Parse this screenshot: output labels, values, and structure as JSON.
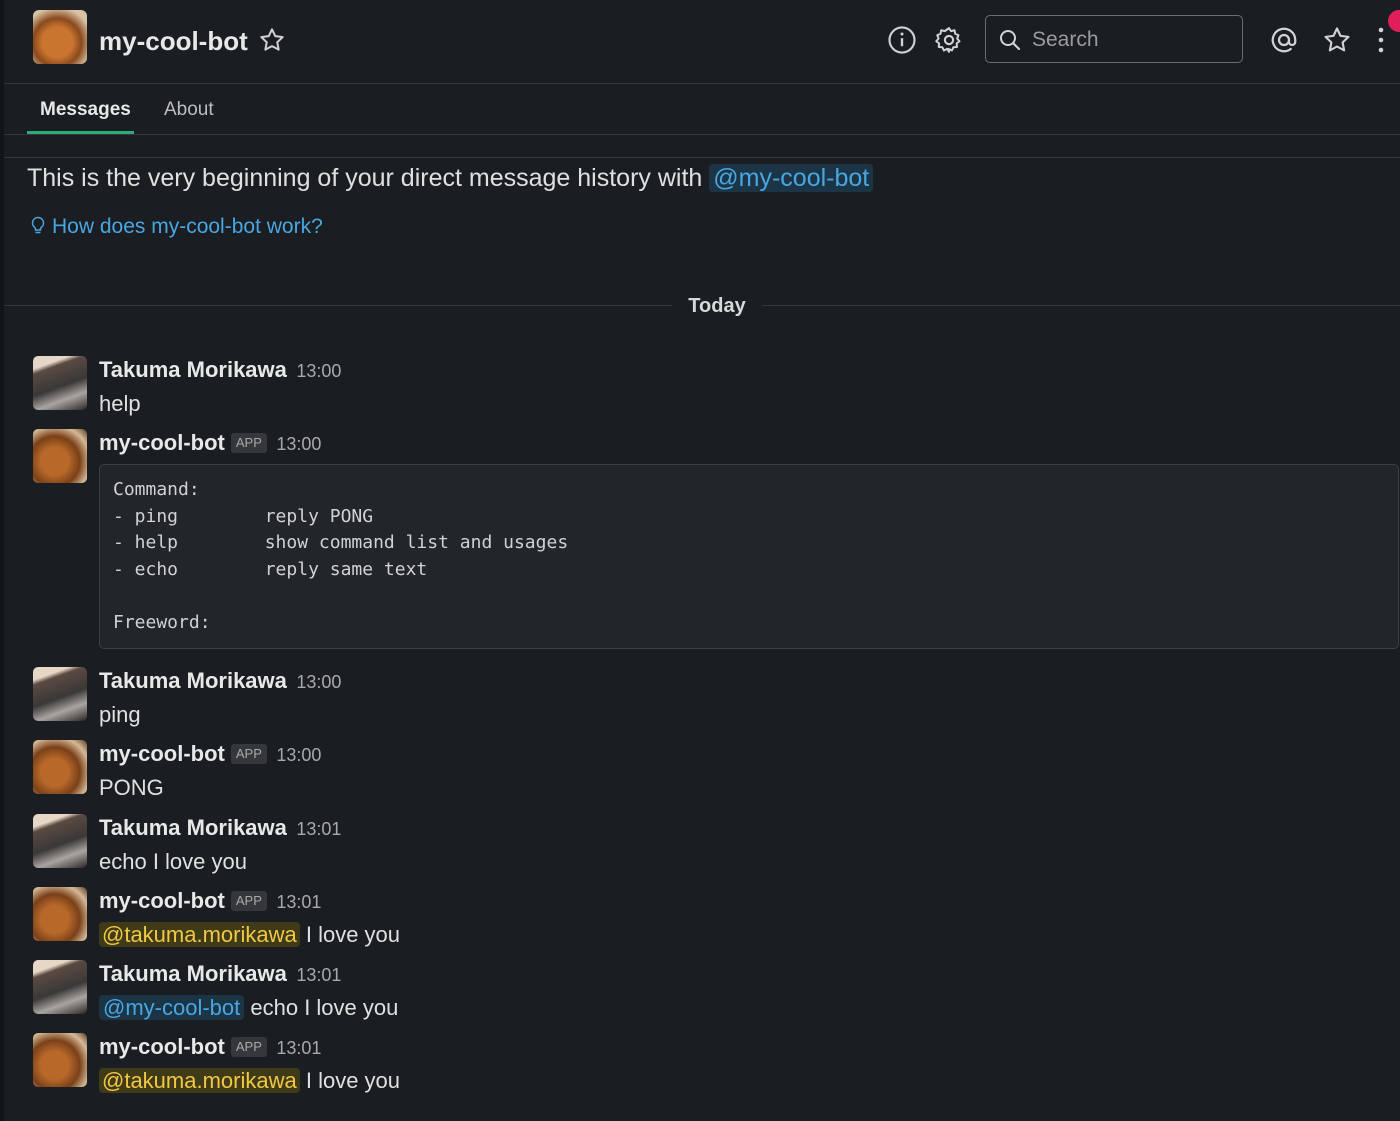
{
  "header": {
    "title": "my-cool-bot",
    "search_placeholder": "Search",
    "icons": [
      "info-icon",
      "gear-icon",
      "search-icon",
      "mention-icon",
      "star-icon",
      "more-icon"
    ]
  },
  "tabs": {
    "messages": "Messages",
    "about": "About"
  },
  "intro": {
    "text": "This is the very beginning of your direct message history with",
    "mention": "@my-cool-bot",
    "howto": "How does my-cool-bot work?"
  },
  "divider": "Today",
  "app_badge": "APP",
  "messages": [
    {
      "author": "Takuma Morikawa",
      "time": "13:00",
      "text": "help"
    },
    {
      "author": "my-cool-bot",
      "time": "13:00",
      "code": [
        "Command:",
        "- ping        reply PONG",
        "- help        show command list and usages",
        "- echo        reply same text",
        "",
        "Freeword:"
      ]
    },
    {
      "author": "Takuma Morikawa",
      "time": "13:00",
      "text": "ping"
    },
    {
      "author": "my-cool-bot",
      "time": "13:00",
      "text": "PONG"
    },
    {
      "author": "Takuma Morikawa",
      "time": "13:01",
      "text": "echo I love you"
    },
    {
      "author": "my-cool-bot",
      "time": "13:01",
      "mention": "@takuma.morikawa",
      "text": " I love you"
    },
    {
      "author": "Takuma Morikawa",
      "time": "13:01",
      "mention": "@my-cool-bot",
      "text": " echo I love you"
    },
    {
      "author": "my-cool-bot",
      "time": "13:01",
      "mention": "@takuma.morikawa",
      "text": " I love you"
    }
  ],
  "colors": {
    "background": "#1a1d21",
    "link": "#4aa6e0",
    "mention_self": "#f2c744",
    "tab_accent": "#2bac76"
  }
}
